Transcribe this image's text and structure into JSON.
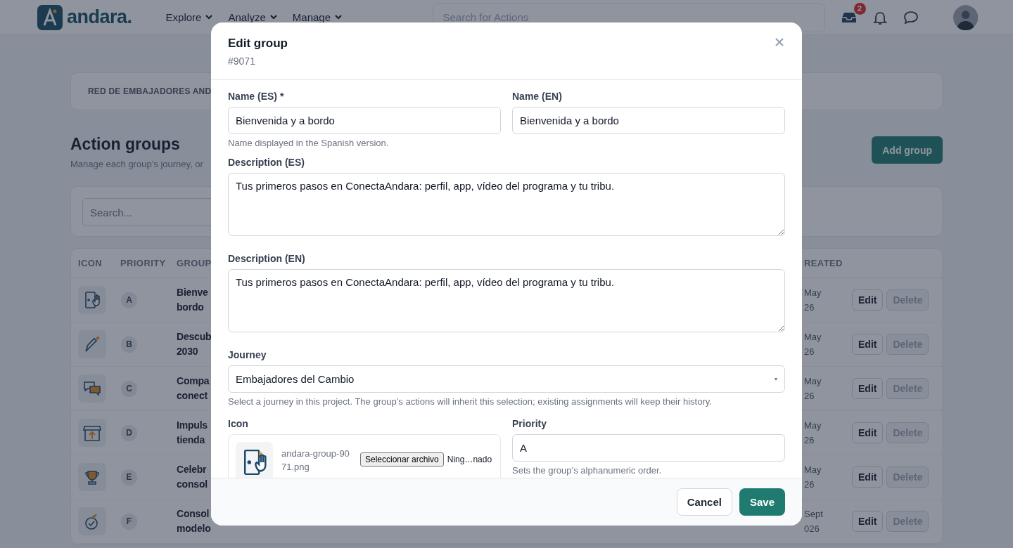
{
  "header": {
    "logo_text": "andara.",
    "nav": [
      {
        "label": "Explore"
      },
      {
        "label": "Analyze"
      },
      {
        "label": "Manage"
      }
    ],
    "search": {
      "placeholder": "Search for Actions"
    },
    "inbox_badge": "2"
  },
  "page": {
    "breadcrumb": "RED DE EMBAJADORES AND",
    "title": "Action groups",
    "subtitle": "Manage each group’s journey, or",
    "add_button": "Add group",
    "search": {
      "placeholder": "Search..."
    },
    "table": {
      "columns": [
        "ICON",
        "PRIORITY",
        "GROUP",
        "REATED"
      ],
      "rows": [
        {
          "kind": "door",
          "priority": "A",
          "group": [
            "Bienve",
            "bordo"
          ],
          "created": [
            "May",
            "26"
          ],
          "actions": [
            "Edit",
            "Delete"
          ]
        },
        {
          "kind": "pen",
          "priority": "B",
          "group": [
            "Descub",
            "2030"
          ],
          "created": [
            "May",
            "26"
          ],
          "actions": [
            "Edit",
            "Delete"
          ]
        },
        {
          "kind": "chat",
          "priority": "C",
          "group": [
            "Compa",
            "conect"
          ],
          "created": [
            "May",
            "26"
          ],
          "actions": [
            "Edit",
            "Delete"
          ]
        },
        {
          "kind": "store",
          "priority": "D",
          "group": [
            "Impuls",
            "tienda"
          ],
          "created": [
            "May",
            "26"
          ],
          "actions": [
            "Edit",
            "Delete"
          ]
        },
        {
          "kind": "trophy",
          "priority": "E",
          "group": [
            "Celebr",
            "consol"
          ],
          "created": [
            "May",
            "26"
          ],
          "actions": [
            "Edit",
            "Delete"
          ]
        },
        {
          "kind": "apple",
          "priority": "F",
          "group": [
            "Consol",
            "modelo"
          ],
          "created": [
            "Sept",
            "026"
          ],
          "actions": [
            "Edit",
            "Delete"
          ]
        }
      ]
    }
  },
  "modal": {
    "title": "Edit group",
    "subtitle": "#9071",
    "name_es": {
      "label": "Name (ES) *",
      "value": "Bienvenida y a bordo",
      "hint": "Name displayed in the Spanish version."
    },
    "name_en": {
      "label": "Name (EN)",
      "value": "Bienvenida y a bordo"
    },
    "description_es": {
      "label": "Description (ES)",
      "value": "Tus primeros pasos en ConectaAndara: perfil, app, vídeo del programa y tu tribu."
    },
    "description_en": {
      "label": "Description (EN)",
      "value": "Tus primeros pasos en ConectaAndara: perfil, app, vídeo del programa y tu tribu."
    },
    "journey": {
      "label": "Journey",
      "value": "Embajadores del Cambio",
      "hint": "Select a journey in this project. The group’s actions will inherit this selection; existing assignments will keep their history."
    },
    "icon": {
      "label": "Icon",
      "file_name": [
        "andara-group-90",
        "71.png"
      ],
      "choose_button": "Seleccionar archivo",
      "file_status": "Ning…nado"
    },
    "priority": {
      "label": "Priority",
      "value": "A",
      "hint": "Sets the group’s alphanumeric order."
    },
    "buttons": {
      "cancel": "Cancel",
      "save": "Save"
    }
  }
}
